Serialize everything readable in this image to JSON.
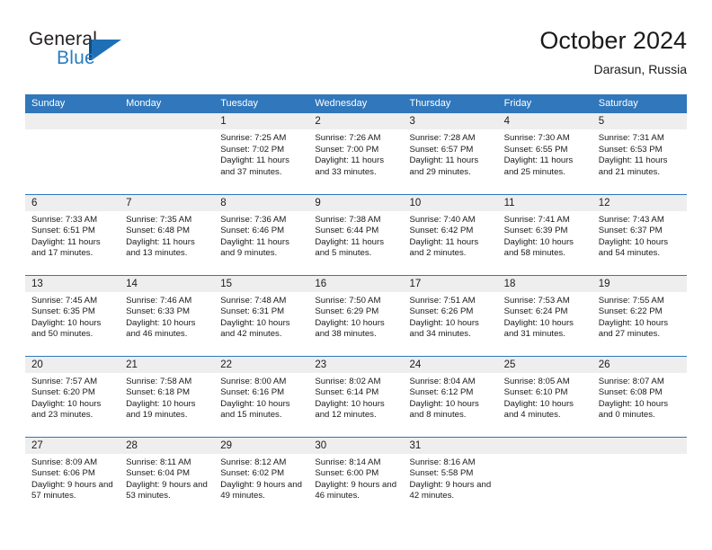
{
  "brand": {
    "name_top": "General",
    "name_bottom": "Blue",
    "flag_icon": "blue-triangle-flag-icon",
    "color_dark": "#231f20",
    "color_blue": "#2b7cc0"
  },
  "header": {
    "title": "October 2024",
    "subtitle": "Darasun, Russia",
    "accent_color": "#3077bc"
  },
  "calendar": {
    "weekdays": [
      "Sunday",
      "Monday",
      "Tuesday",
      "Wednesday",
      "Thursday",
      "Friday",
      "Saturday"
    ],
    "labels": {
      "sunrise": "Sunrise:",
      "sunset": "Sunset:",
      "daylight": "Daylight:"
    },
    "weeks": [
      [
        {
          "day": ""
        },
        {
          "day": ""
        },
        {
          "day": "1",
          "sunrise": "Sunrise: 7:25 AM",
          "sunset": "Sunset: 7:02 PM",
          "daylight": "Daylight: 11 hours and 37 minutes."
        },
        {
          "day": "2",
          "sunrise": "Sunrise: 7:26 AM",
          "sunset": "Sunset: 7:00 PM",
          "daylight": "Daylight: 11 hours and 33 minutes."
        },
        {
          "day": "3",
          "sunrise": "Sunrise: 7:28 AM",
          "sunset": "Sunset: 6:57 PM",
          "daylight": "Daylight: 11 hours and 29 minutes."
        },
        {
          "day": "4",
          "sunrise": "Sunrise: 7:30 AM",
          "sunset": "Sunset: 6:55 PM",
          "daylight": "Daylight: 11 hours and 25 minutes."
        },
        {
          "day": "5",
          "sunrise": "Sunrise: 7:31 AM",
          "sunset": "Sunset: 6:53 PM",
          "daylight": "Daylight: 11 hours and 21 minutes."
        }
      ],
      [
        {
          "day": "6",
          "sunrise": "Sunrise: 7:33 AM",
          "sunset": "Sunset: 6:51 PM",
          "daylight": "Daylight: 11 hours and 17 minutes."
        },
        {
          "day": "7",
          "sunrise": "Sunrise: 7:35 AM",
          "sunset": "Sunset: 6:48 PM",
          "daylight": "Daylight: 11 hours and 13 minutes."
        },
        {
          "day": "8",
          "sunrise": "Sunrise: 7:36 AM",
          "sunset": "Sunset: 6:46 PM",
          "daylight": "Daylight: 11 hours and 9 minutes."
        },
        {
          "day": "9",
          "sunrise": "Sunrise: 7:38 AM",
          "sunset": "Sunset: 6:44 PM",
          "daylight": "Daylight: 11 hours and 5 minutes."
        },
        {
          "day": "10",
          "sunrise": "Sunrise: 7:40 AM",
          "sunset": "Sunset: 6:42 PM",
          "daylight": "Daylight: 11 hours and 2 minutes."
        },
        {
          "day": "11",
          "sunrise": "Sunrise: 7:41 AM",
          "sunset": "Sunset: 6:39 PM",
          "daylight": "Daylight: 10 hours and 58 minutes."
        },
        {
          "day": "12",
          "sunrise": "Sunrise: 7:43 AM",
          "sunset": "Sunset: 6:37 PM",
          "daylight": "Daylight: 10 hours and 54 minutes."
        }
      ],
      [
        {
          "day": "13",
          "sunrise": "Sunrise: 7:45 AM",
          "sunset": "Sunset: 6:35 PM",
          "daylight": "Daylight: 10 hours and 50 minutes."
        },
        {
          "day": "14",
          "sunrise": "Sunrise: 7:46 AM",
          "sunset": "Sunset: 6:33 PM",
          "daylight": "Daylight: 10 hours and 46 minutes."
        },
        {
          "day": "15",
          "sunrise": "Sunrise: 7:48 AM",
          "sunset": "Sunset: 6:31 PM",
          "daylight": "Daylight: 10 hours and 42 minutes."
        },
        {
          "day": "16",
          "sunrise": "Sunrise: 7:50 AM",
          "sunset": "Sunset: 6:29 PM",
          "daylight": "Daylight: 10 hours and 38 minutes."
        },
        {
          "day": "17",
          "sunrise": "Sunrise: 7:51 AM",
          "sunset": "Sunset: 6:26 PM",
          "daylight": "Daylight: 10 hours and 34 minutes."
        },
        {
          "day": "18",
          "sunrise": "Sunrise: 7:53 AM",
          "sunset": "Sunset: 6:24 PM",
          "daylight": "Daylight: 10 hours and 31 minutes."
        },
        {
          "day": "19",
          "sunrise": "Sunrise: 7:55 AM",
          "sunset": "Sunset: 6:22 PM",
          "daylight": "Daylight: 10 hours and 27 minutes."
        }
      ],
      [
        {
          "day": "20",
          "sunrise": "Sunrise: 7:57 AM",
          "sunset": "Sunset: 6:20 PM",
          "daylight": "Daylight: 10 hours and 23 minutes."
        },
        {
          "day": "21",
          "sunrise": "Sunrise: 7:58 AM",
          "sunset": "Sunset: 6:18 PM",
          "daylight": "Daylight: 10 hours and 19 minutes."
        },
        {
          "day": "22",
          "sunrise": "Sunrise: 8:00 AM",
          "sunset": "Sunset: 6:16 PM",
          "daylight": "Daylight: 10 hours and 15 minutes."
        },
        {
          "day": "23",
          "sunrise": "Sunrise: 8:02 AM",
          "sunset": "Sunset: 6:14 PM",
          "daylight": "Daylight: 10 hours and 12 minutes."
        },
        {
          "day": "24",
          "sunrise": "Sunrise: 8:04 AM",
          "sunset": "Sunset: 6:12 PM",
          "daylight": "Daylight: 10 hours and 8 minutes."
        },
        {
          "day": "25",
          "sunrise": "Sunrise: 8:05 AM",
          "sunset": "Sunset: 6:10 PM",
          "daylight": "Daylight: 10 hours and 4 minutes."
        },
        {
          "day": "26",
          "sunrise": "Sunrise: 8:07 AM",
          "sunset": "Sunset: 6:08 PM",
          "daylight": "Daylight: 10 hours and 0 minutes."
        }
      ],
      [
        {
          "day": "27",
          "sunrise": "Sunrise: 8:09 AM",
          "sunset": "Sunset: 6:06 PM",
          "daylight": "Daylight: 9 hours and 57 minutes."
        },
        {
          "day": "28",
          "sunrise": "Sunrise: 8:11 AM",
          "sunset": "Sunset: 6:04 PM",
          "daylight": "Daylight: 9 hours and 53 minutes."
        },
        {
          "day": "29",
          "sunrise": "Sunrise: 8:12 AM",
          "sunset": "Sunset: 6:02 PM",
          "daylight": "Daylight: 9 hours and 49 minutes."
        },
        {
          "day": "30",
          "sunrise": "Sunrise: 8:14 AM",
          "sunset": "Sunset: 6:00 PM",
          "daylight": "Daylight: 9 hours and 46 minutes."
        },
        {
          "day": "31",
          "sunrise": "Sunrise: 8:16 AM",
          "sunset": "Sunset: 5:58 PM",
          "daylight": "Daylight: 9 hours and 42 minutes."
        },
        {
          "day": ""
        },
        {
          "day": ""
        }
      ]
    ]
  }
}
